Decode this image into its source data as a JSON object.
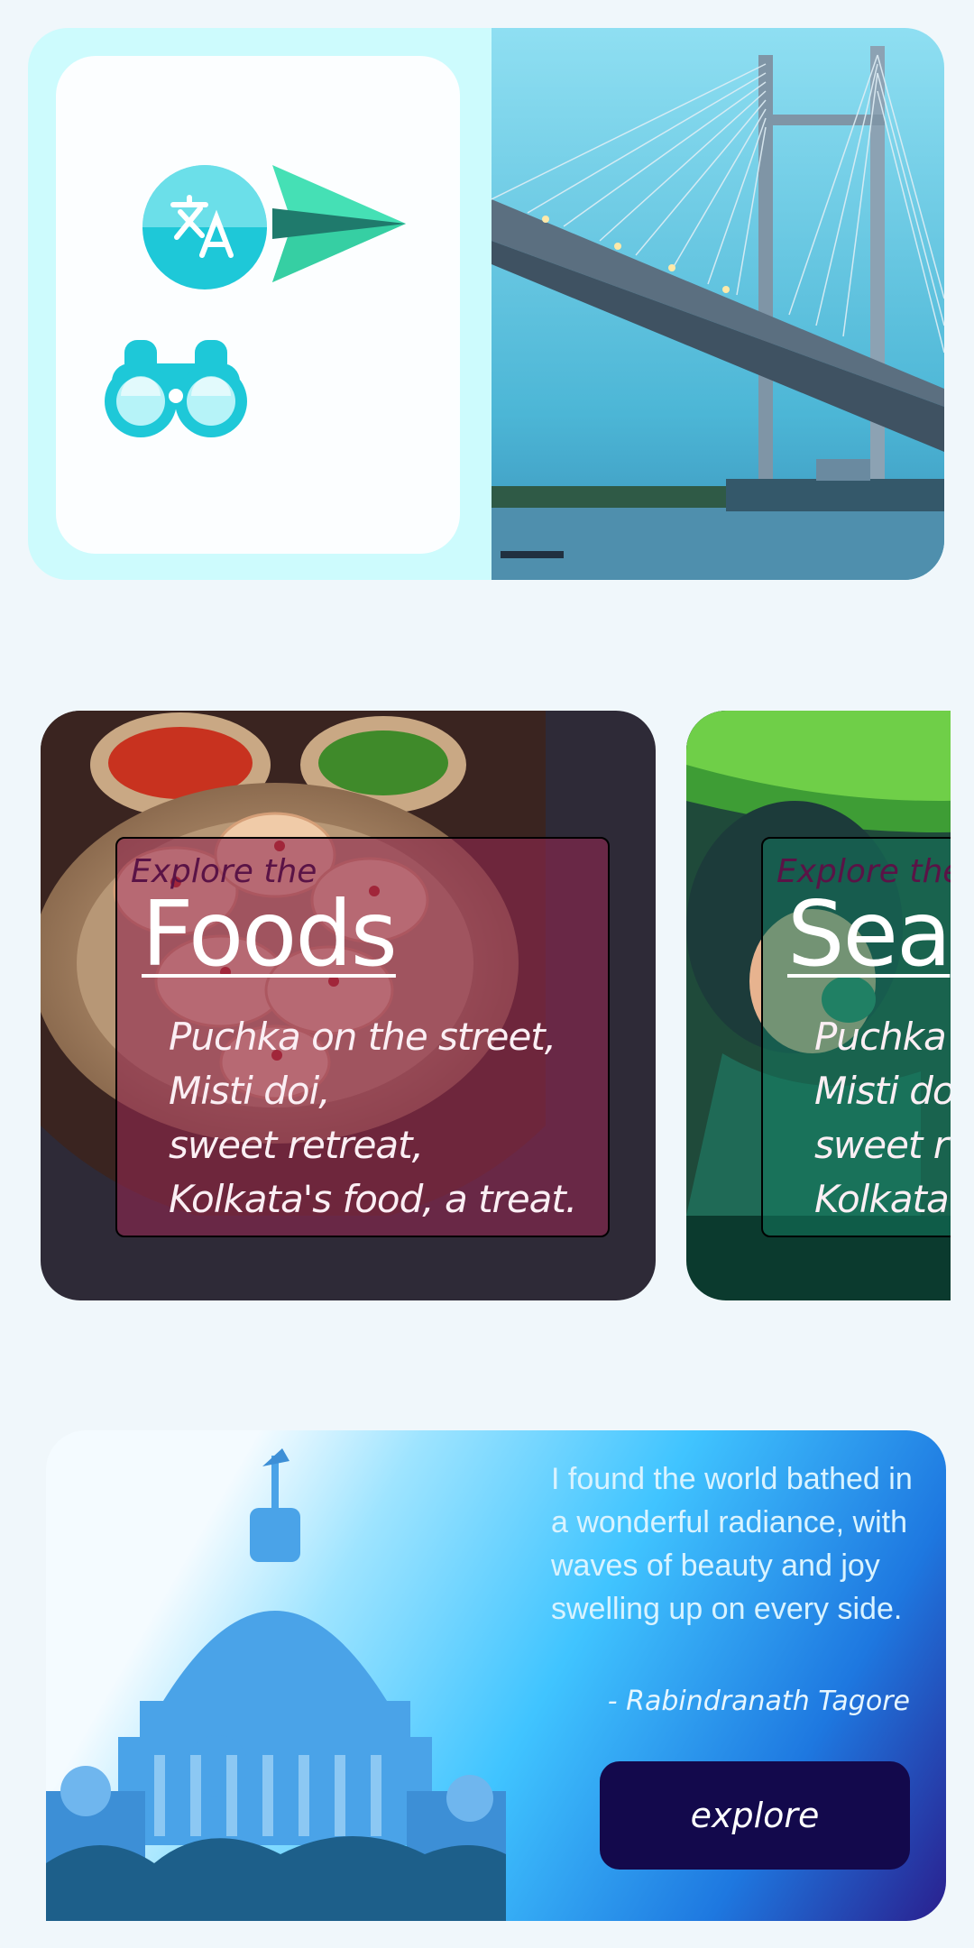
{
  "top_card": {
    "icons": [
      "translate-icon",
      "send-icon",
      "binoculars-icon"
    ],
    "image": "howrah-bridge-photo"
  },
  "cards": [
    {
      "subtitle": "Explore the",
      "title": "Foods",
      "poem": [
        "Puchka on the street,",
        "Misti doi,",
        "sweet retreat,",
        "Kolkata's food, a treat."
      ],
      "image": "momos-dumplings-photo"
    },
    {
      "subtitle": "Explore the",
      "title": "Sea",
      "poem": [
        "Puchka",
        "Misti do",
        "sweet r",
        "Kolkata"
      ],
      "image": "anime-leaf-illustration"
    }
  ],
  "quote": {
    "text": "I found the world bathed in a wonderful radiance, with waves of beauty and joy swelling up on every side.",
    "author": "- Rabindranath Tagore",
    "button_label": "explore",
    "image": "victoria-memorial-photo"
  },
  "colors": {
    "page_bg": "#f0f7fb",
    "top_card_bg": "#cdfbfd",
    "accent_teal": "#1ec8d8",
    "foods_card_bg": "#2e2a37",
    "seas_card_bg": "#0b3a2e",
    "button_bg": "#13094c"
  }
}
